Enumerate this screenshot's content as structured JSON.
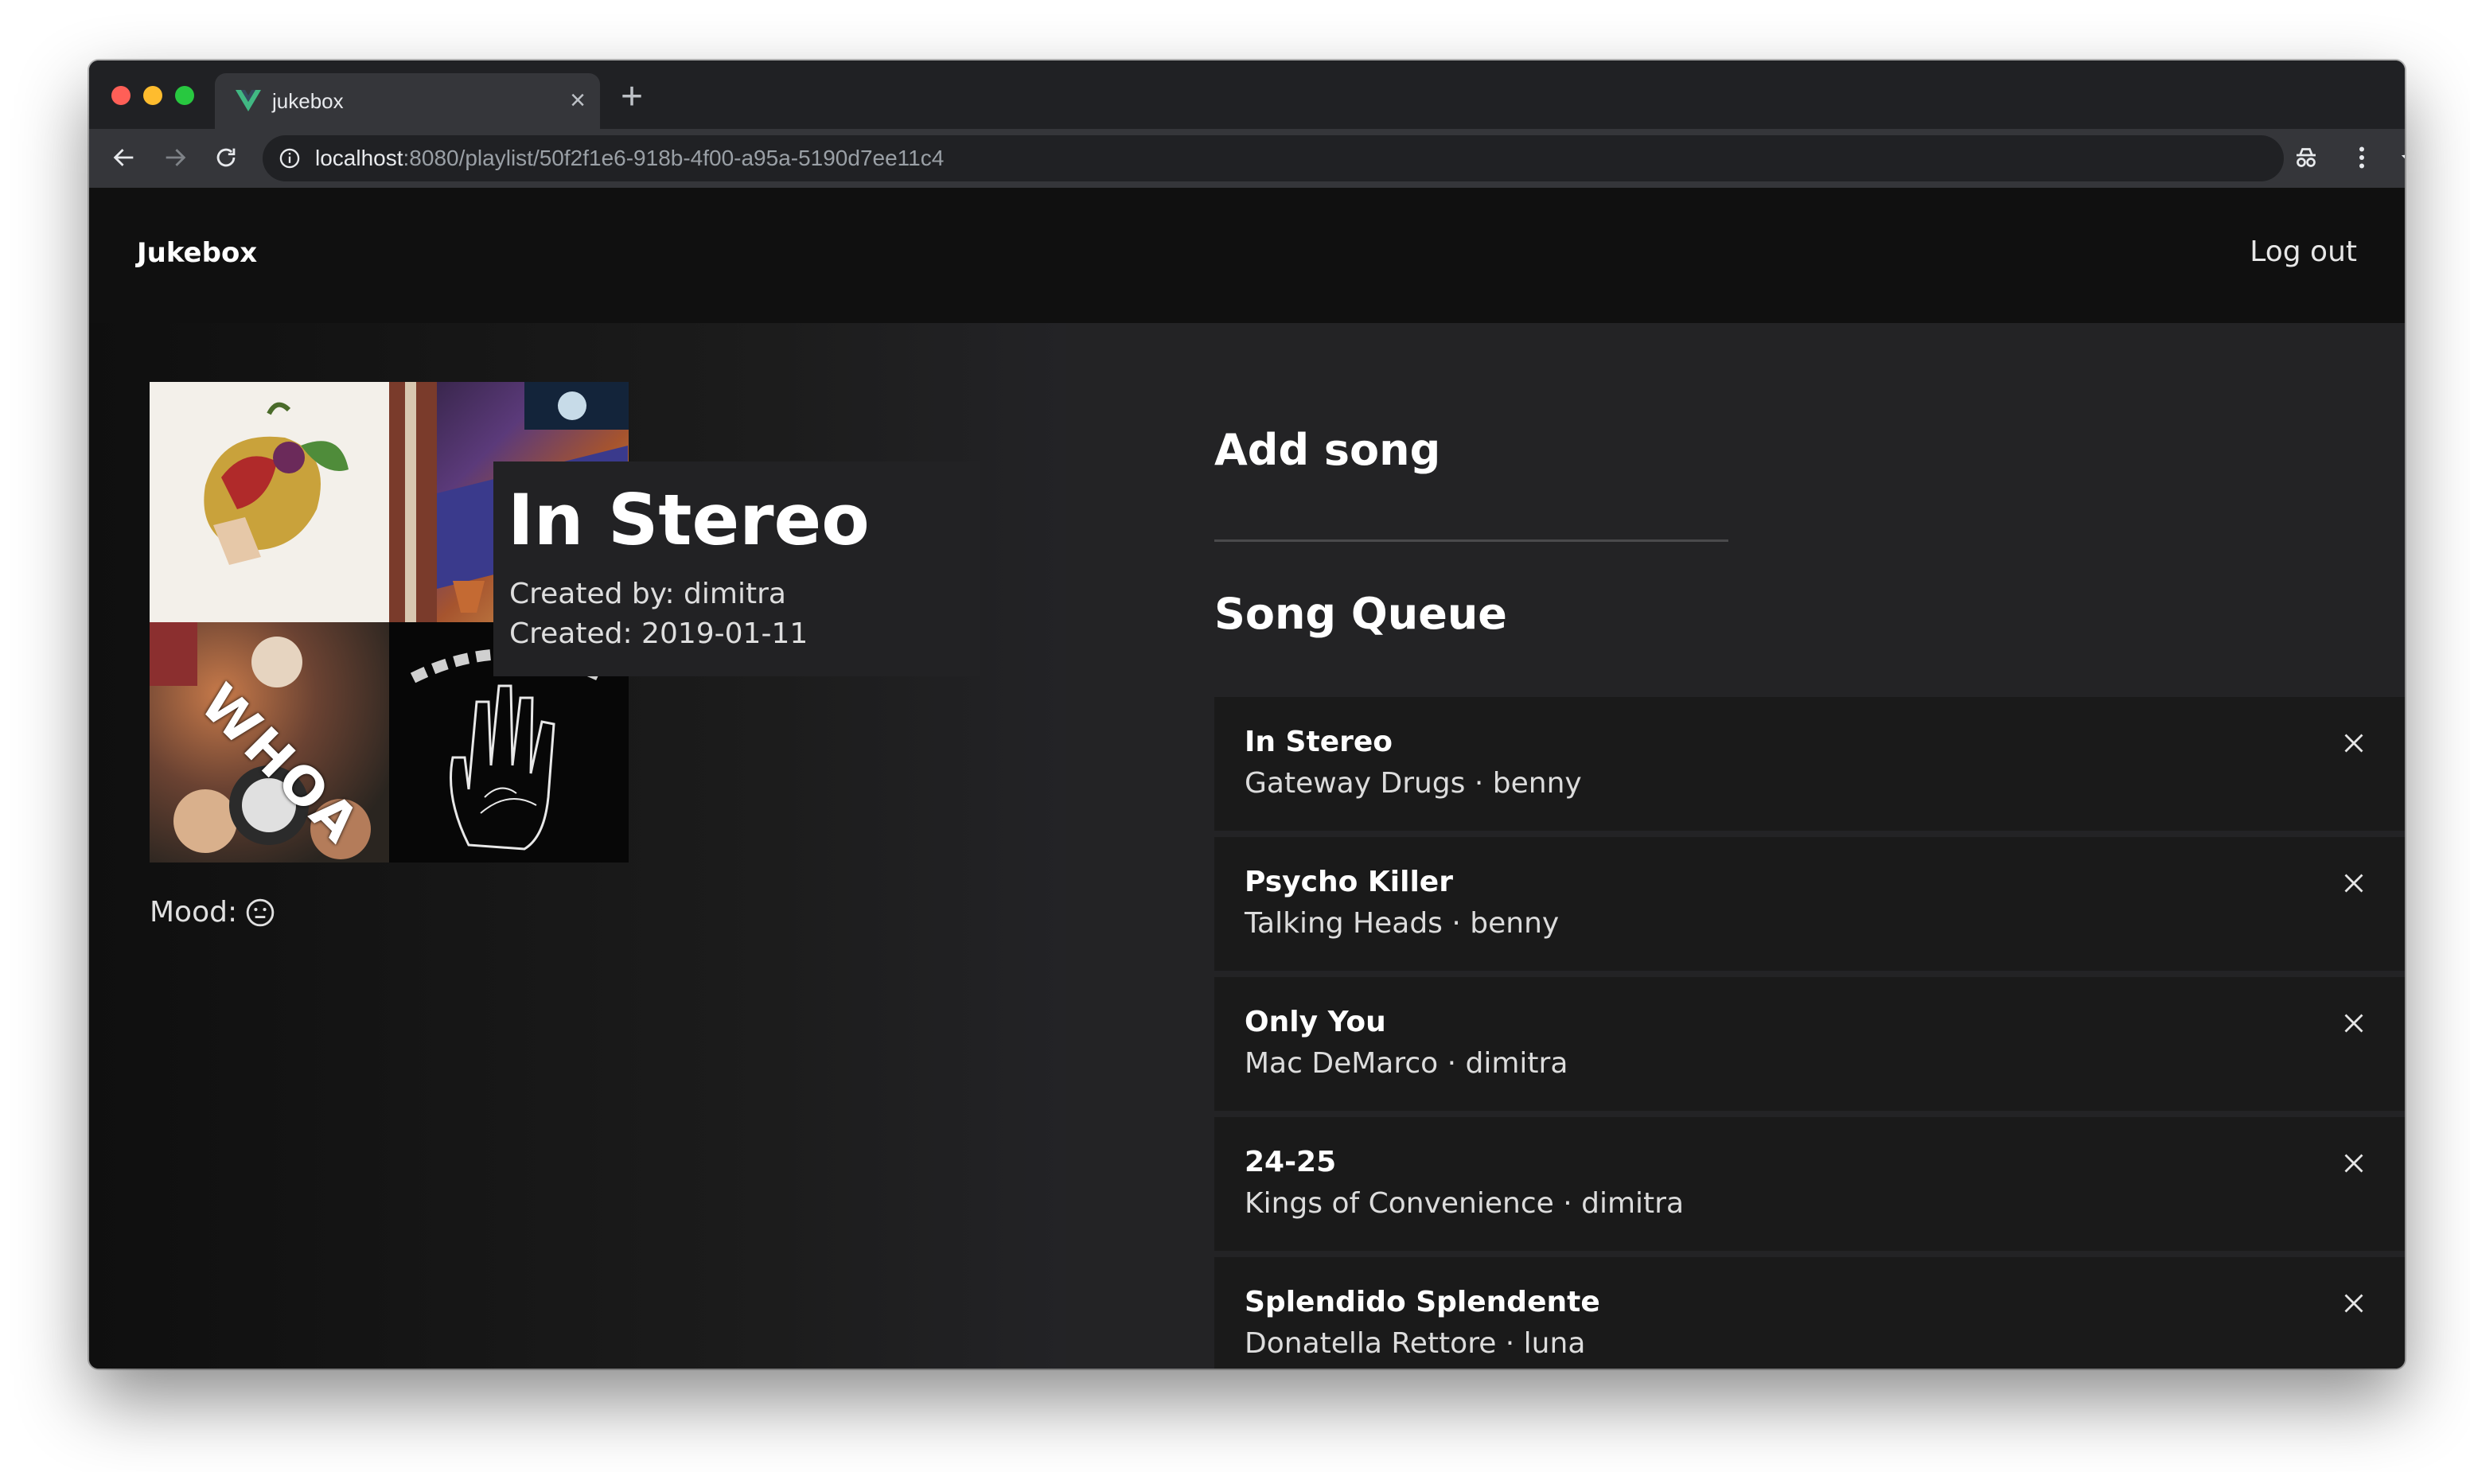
{
  "browser": {
    "tab_title": "jukebox",
    "tab_favicon": "vue-logo-icon",
    "url_host": "localhost",
    "url_rest": ":8080/playlist/50f2f1e6-918b-4f00-a95a-5190d7ee11c4",
    "new_tab_label": "+",
    "tab_close_label": "×"
  },
  "navbar": {
    "brand": "Jukebox",
    "logout": "Log out"
  },
  "playlist": {
    "title": "In Stereo",
    "created_by": "Created by: dimitra",
    "created": "Created: 2019-01-11",
    "mood_label": "Mood:",
    "mood_icon": "neutral-face-icon",
    "cover_text": "WHOA"
  },
  "sections": {
    "add_song": "Add song",
    "song_queue": "Song Queue"
  },
  "queue": [
    {
      "title": "In Stereo",
      "subtitle": "Gateway Drugs · benny"
    },
    {
      "title": "Psycho Killer",
      "subtitle": "Talking Heads · benny"
    },
    {
      "title": "Only You",
      "subtitle": "Mac DeMarco · dimitra"
    },
    {
      "title": "24-25",
      "subtitle": "Kings of Convenience · dimitra"
    },
    {
      "title": "Splendido Splendente",
      "subtitle": "Donatella Rettore · luna"
    }
  ],
  "colors": {
    "vue_green": "#41b883",
    "navbar_bg": "#101010",
    "card_bg": "#1a1a1a"
  }
}
